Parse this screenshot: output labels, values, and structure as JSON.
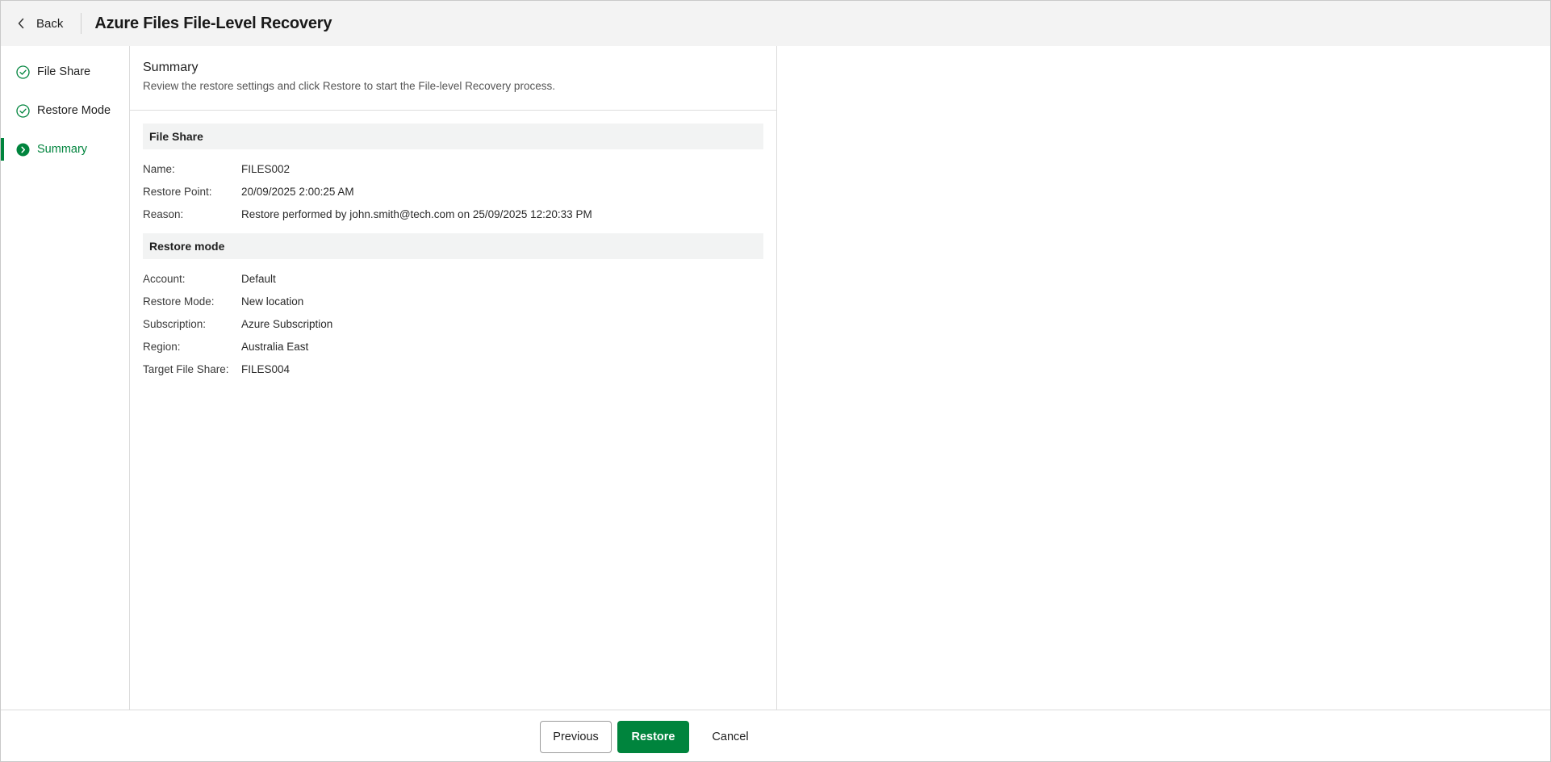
{
  "header": {
    "back_label": "Back",
    "title": "Azure Files File-Level Recovery"
  },
  "sidebar": {
    "steps": [
      {
        "label": "File Share",
        "state": "completed"
      },
      {
        "label": "Restore Mode",
        "state": "completed"
      },
      {
        "label": "Summary",
        "state": "active"
      }
    ]
  },
  "main": {
    "title": "Summary",
    "description": "Review the restore settings and click Restore to start the File-level Recovery process.",
    "sections": [
      {
        "title": "File Share",
        "rows": [
          {
            "key": "Name:",
            "value": "FILES002"
          },
          {
            "key": "Restore Point:",
            "value": "20/09/2025 2:00:25 AM"
          },
          {
            "key": "Reason:",
            "value": "Restore performed by john.smith@tech.com on 25/09/2025 12:20:33 PM"
          }
        ]
      },
      {
        "title": "Restore mode",
        "rows": [
          {
            "key": "Account:",
            "value": "Default"
          },
          {
            "key": "Restore Mode:",
            "value": "New location"
          },
          {
            "key": "Subscription:",
            "value": "Azure Subscription"
          },
          {
            "key": "Region:",
            "value": "Australia East"
          },
          {
            "key": "Target File Share:",
            "value": "FILES004"
          }
        ]
      }
    ]
  },
  "footer": {
    "previous_label": "Previous",
    "restore_label": "Restore",
    "cancel_label": "Cancel"
  },
  "colors": {
    "accent": "#00843d",
    "header_bg": "#f3f3f3",
    "section_bg": "#f2f3f3"
  }
}
